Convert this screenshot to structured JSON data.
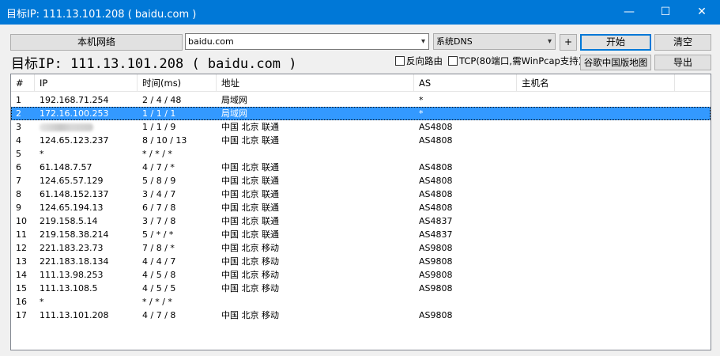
{
  "window": {
    "title": "目标IP: 111.13.101.208 ( baidu.com )",
    "minimize": "—",
    "maximize": "☐",
    "close": "✕"
  },
  "toolbar": {
    "local_network_button": "本机网络",
    "target_value": "baidu.com",
    "dns_value": "系统DNS",
    "plus_button": "+",
    "start_button": "开始",
    "clear_button": "清空",
    "google_map_button": "谷歌中国版地图",
    "export_button": "导出"
  },
  "headline": "目标IP: 111.13.101.208 ( baidu.com )",
  "options": {
    "reverse_route": "反向路由",
    "tcp": "TCP(80端口,需WinPcap支持)"
  },
  "columns": [
    "#",
    "IP",
    "时间(ms)",
    "地址",
    "AS",
    "主机名"
  ],
  "rows": [
    {
      "n": "1",
      "ip": "192.168.71.254",
      "time": "2 / 4 / 48",
      "addr": "局域网",
      "as": "*",
      "host": ""
    },
    {
      "n": "2",
      "ip": "172.16.100.253",
      "time": "1 / 1 / 1",
      "addr": "局域网",
      "as": "*",
      "host": "",
      "selected": true
    },
    {
      "n": "3",
      "ip": "",
      "time": "1 / 1 / 9",
      "addr": "中国 北京 联通",
      "as": "AS4808",
      "host": "",
      "masked": true
    },
    {
      "n": "4",
      "ip": "124.65.123.237",
      "time": "8 / 10 / 13",
      "addr": "中国 北京 联通",
      "as": "AS4808",
      "host": ""
    },
    {
      "n": "5",
      "ip": "*",
      "time": "* / * / *",
      "addr": "",
      "as": "",
      "host": ""
    },
    {
      "n": "6",
      "ip": "61.148.7.57",
      "time": "4 / 7 / *",
      "addr": "中国 北京 联通",
      "as": "AS4808",
      "host": ""
    },
    {
      "n": "7",
      "ip": "124.65.57.129",
      "time": "5 / 8 / 9",
      "addr": "中国 北京 联通",
      "as": "AS4808",
      "host": ""
    },
    {
      "n": "8",
      "ip": "61.148.152.137",
      "time": "3 / 4 / 7",
      "addr": "中国 北京 联通",
      "as": "AS4808",
      "host": ""
    },
    {
      "n": "9",
      "ip": "124.65.194.13",
      "time": "6 / 7 / 8",
      "addr": "中国 北京 联通",
      "as": "AS4808",
      "host": ""
    },
    {
      "n": "10",
      "ip": "219.158.5.14",
      "time": "3 / 7 / 8",
      "addr": "中国 北京 联通",
      "as": "AS4837",
      "host": ""
    },
    {
      "n": "11",
      "ip": "219.158.38.214",
      "time": "5 / * / *",
      "addr": "中国 北京 联通",
      "as": "AS4837",
      "host": ""
    },
    {
      "n": "12",
      "ip": "221.183.23.73",
      "time": "7 / 8 / *",
      "addr": "中国 北京 移动",
      "as": "AS9808",
      "host": ""
    },
    {
      "n": "13",
      "ip": "221.183.18.134",
      "time": "4 / 4 / 7",
      "addr": "中国 北京 移动",
      "as": "AS9808",
      "host": ""
    },
    {
      "n": "14",
      "ip": "111.13.98.253",
      "time": "4 / 5 / 8",
      "addr": "中国 北京 移动",
      "as": "AS9808",
      "host": ""
    },
    {
      "n": "15",
      "ip": "111.13.108.5",
      "time": "4 / 5 / 5",
      "addr": "中国 北京 移动",
      "as": "AS9808",
      "host": ""
    },
    {
      "n": "16",
      "ip": "*",
      "time": "* / * / *",
      "addr": "",
      "as": "",
      "host": ""
    },
    {
      "n": "17",
      "ip": "111.13.101.208",
      "time": "4 / 7 / 8",
      "addr": "中国 北京 移动",
      "as": "AS9808",
      "host": ""
    }
  ],
  "colors": {
    "titlebar": "#0078d7",
    "selection": "#3399ff"
  }
}
